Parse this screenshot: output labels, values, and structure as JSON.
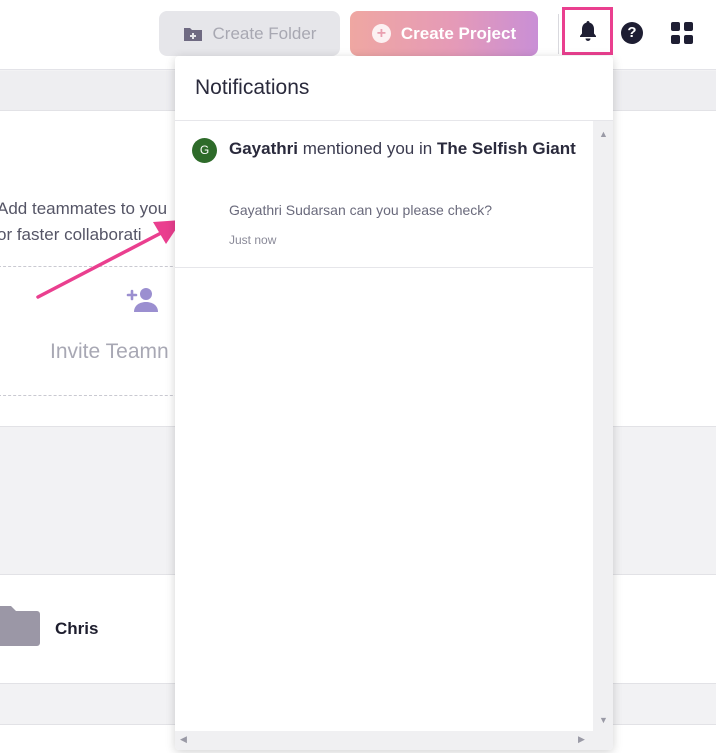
{
  "toolbar": {
    "create_folder_label": "Create Folder",
    "create_project_label": "Create Project",
    "help_glyph": "?"
  },
  "background": {
    "invite_line1": "Add teammates to you",
    "invite_line2": "or faster collaborati",
    "invite_button_label": "Invite Teamn",
    "folder_name": "Chris"
  },
  "notifications": {
    "title": "Notifications",
    "items": [
      {
        "avatar_letter": "G",
        "user": "Gayathri",
        "action": "mentioned you in",
        "target": "The Selfish Giant",
        "message": "Gayathri Sudarsan can you please check?",
        "time": "Just now"
      }
    ]
  },
  "colors": {
    "highlight": "#ea3f8f",
    "avatar_bg": "#2e6b2a",
    "accent_purple": "#9b8fd0"
  },
  "icons": [
    "folder-plus-icon",
    "plus-circle-icon",
    "bell-icon",
    "help-icon",
    "apps-grid-icon",
    "add-person-icon",
    "folder-icon"
  ]
}
